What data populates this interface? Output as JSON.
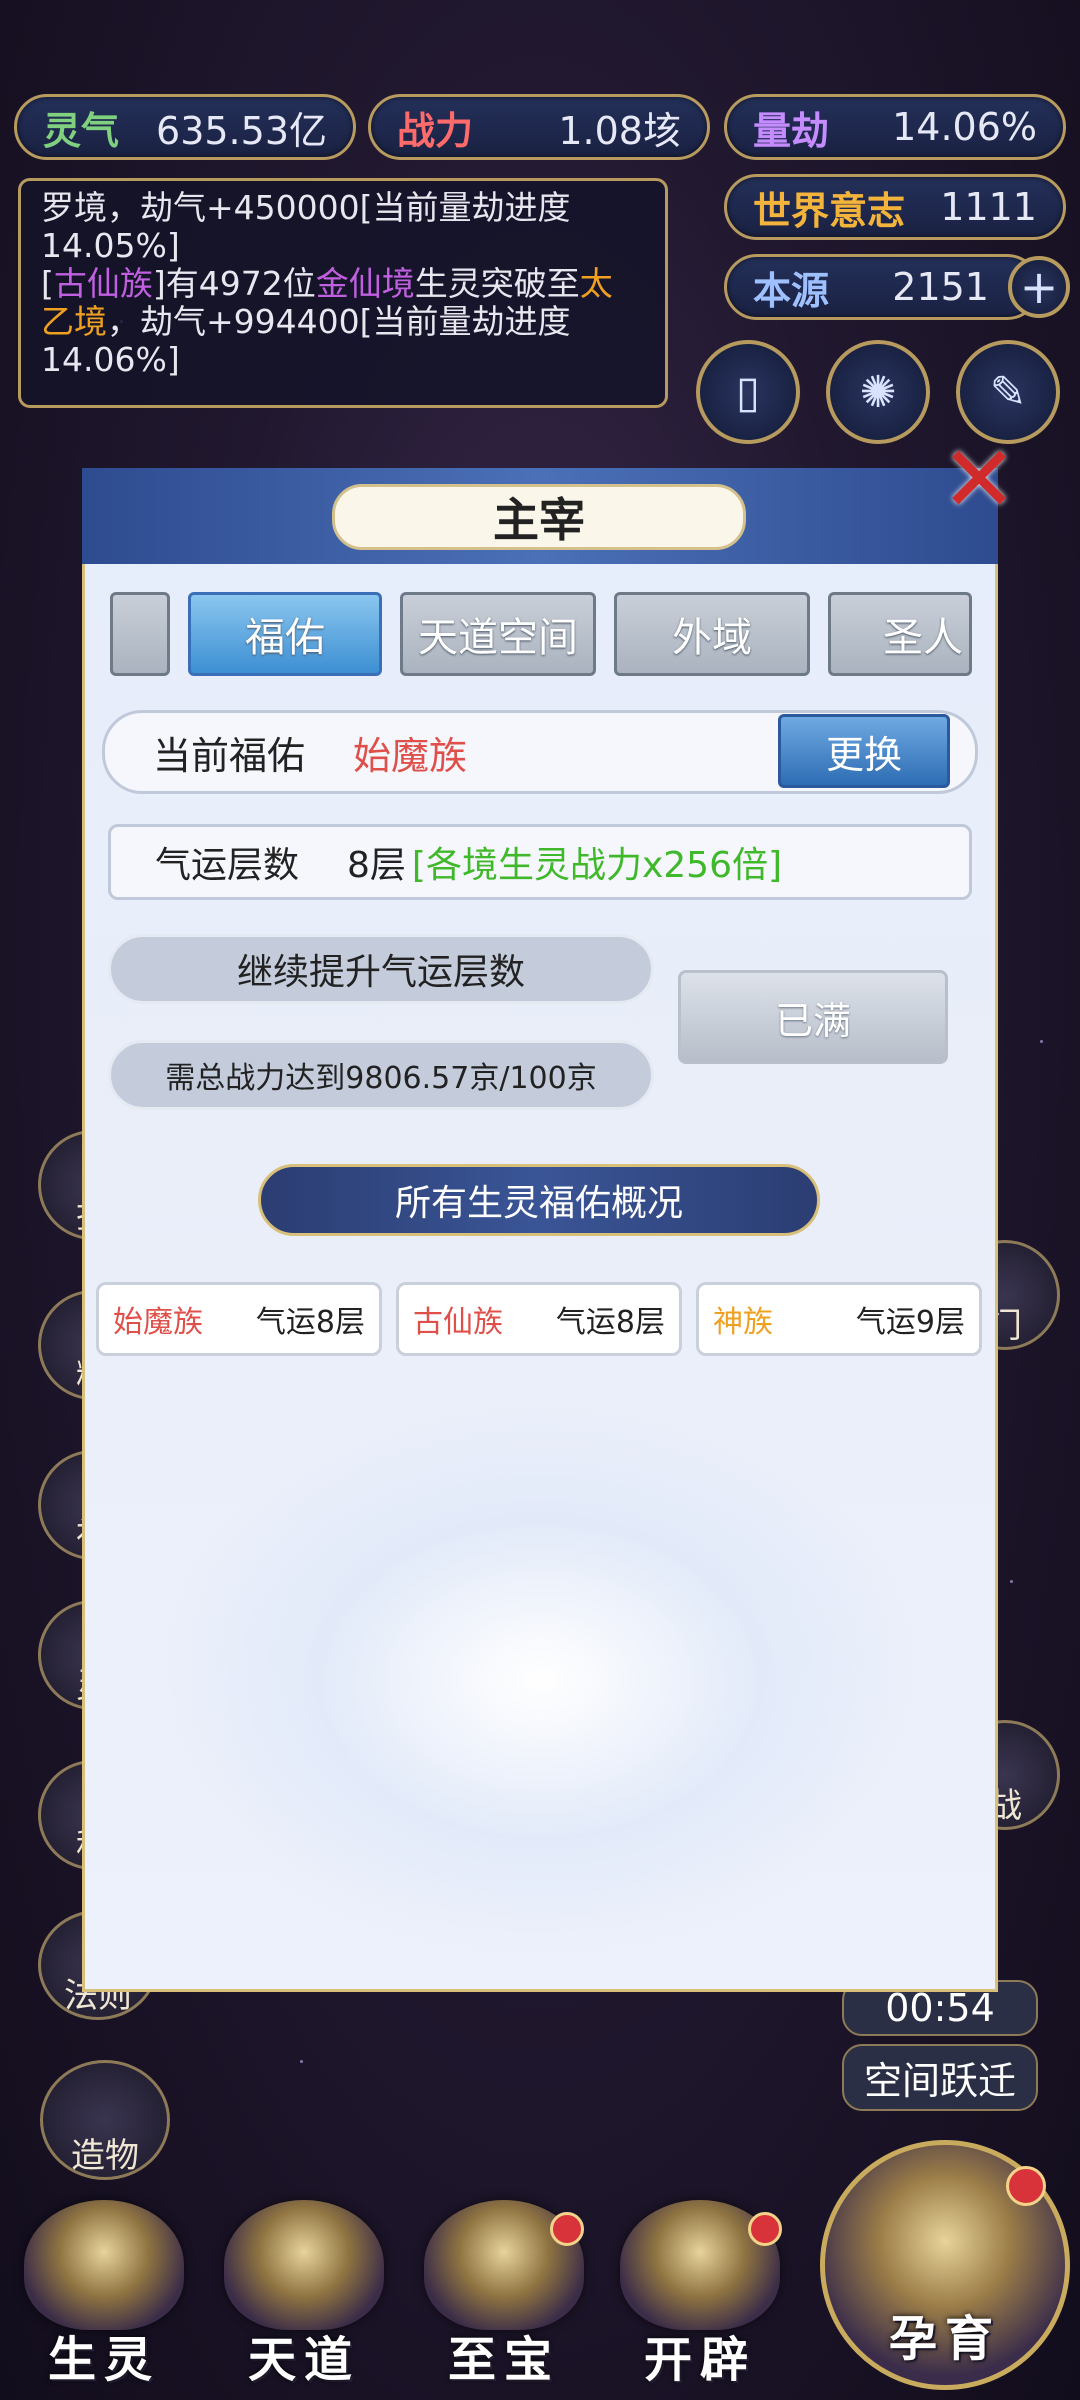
{
  "resources": {
    "lingqi": {
      "label": "灵气",
      "value": "635.53亿"
    },
    "zhanli": {
      "label": "战力",
      "value": "1.08垓"
    },
    "liangjie": {
      "label": "量劫",
      "value": "14.06%"
    },
    "shijie": {
      "label": "世界意志",
      "value": "1111"
    },
    "benyuan": {
      "label": "本源",
      "value": "2151"
    }
  },
  "log": {
    "line1": "罗境，劫气+450000[当前量劫进度14.05%]",
    "line2_part1": "[",
    "line2_race": "古仙族",
    "line2_part2": "]有4972位",
    "line2_realm": "金仙境",
    "line2_part3": "生灵突破至",
    "line2_target": "太乙境",
    "line2_part4": "，劫气+994400[当前量劫进度14.06%]"
  },
  "side_left": [
    "技",
    "精",
    "神",
    "灵",
    "科",
    "法则",
    "造物"
  ],
  "side_right": [
    "门",
    "战"
  ],
  "timer": {
    "value": "00:54",
    "label": "空间跃迁"
  },
  "nav": {
    "shengling": "生灵",
    "tiandao": "天道",
    "zhibao": "至宝",
    "kaipi": "开辟",
    "yunyu": "孕育"
  },
  "modal": {
    "title": "主宰",
    "close": "✕",
    "tabs": [
      "福佑",
      "天道空间",
      "外域",
      "圣人"
    ],
    "current_label": "当前福佑",
    "current_value": "始魔族",
    "change_button": "更换",
    "luck_label": "气运层数",
    "luck_value": "8层",
    "luck_bonus": "[各境生灵战力x256倍]",
    "upgrade_label": "继续提升气运层数",
    "requirement": "需总战力达到9806.57京/100京",
    "full_button": "已满",
    "overview_title": "所有生灵福佑概况",
    "races": [
      {
        "name": "始魔族",
        "luck": "气运8层",
        "color": "#e0504b"
      },
      {
        "name": "古仙族",
        "luck": "气运8层",
        "color": "#e0504b"
      },
      {
        "name": "神族",
        "luck": "气运9层",
        "color": "#f0a020"
      }
    ]
  },
  "colors": {
    "accent": "#b79a5e",
    "green": "#3fb82a",
    "red": "#e0504b",
    "purple": "#c060e0",
    "orange": "#f0a020"
  }
}
